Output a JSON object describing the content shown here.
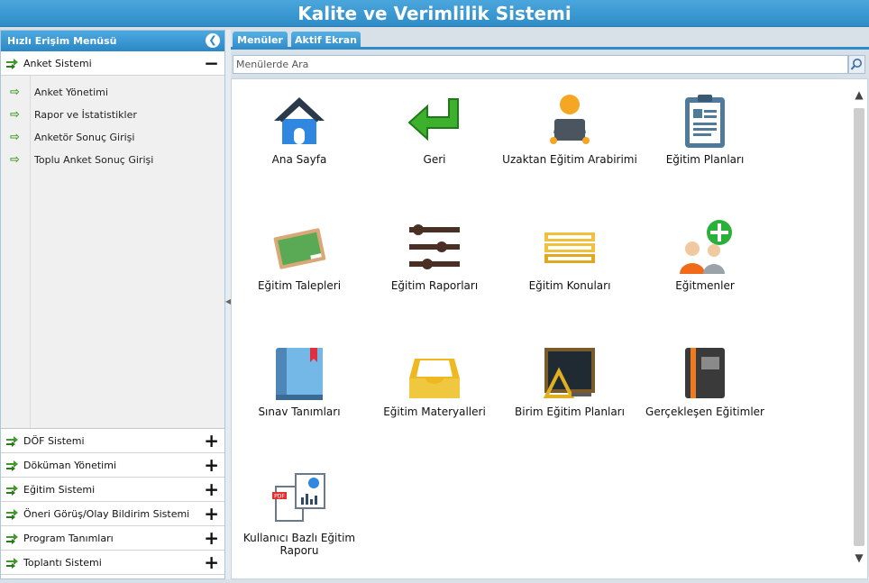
{
  "app": {
    "title": "Kalite ve Verimlilik Sistemi"
  },
  "sidebar": {
    "header": "Hızlı Erişim Menüsü",
    "open_section": {
      "label": "Anket Sistemi",
      "toggle": "−",
      "items": [
        {
          "label": "Anket Yönetimi"
        },
        {
          "label": "Rapor ve İstatistikler"
        },
        {
          "label": "Anketör Sonuç Girişi"
        },
        {
          "label": "Toplu Anket Sonuç Girişi"
        }
      ]
    },
    "sections": [
      {
        "label": "DÖF Sistemi",
        "toggle": "+"
      },
      {
        "label": "Döküman Yönetimi",
        "toggle": "+"
      },
      {
        "label": "Eğitim Sistemi",
        "toggle": "+"
      },
      {
        "label": "Öneri Görüş/Olay Bildirim Sistemi",
        "toggle": "+"
      },
      {
        "label": "Program Tanımları",
        "toggle": "+"
      },
      {
        "label": "Toplantı Sistemi",
        "toggle": "+"
      }
    ]
  },
  "tabs": [
    {
      "label": "Menüler"
    },
    {
      "label": "Aktif Ekran"
    }
  ],
  "search": {
    "placeholder": "Menülerde Ara"
  },
  "tiles": [
    {
      "label": "Ana Sayfa",
      "icon": "home-icon"
    },
    {
      "label": "Geri",
      "icon": "back-arrow-icon"
    },
    {
      "label": "Uzaktan Eğitim Arabirimi",
      "icon": "remote-learner-icon"
    },
    {
      "label": "Eğitim Planları",
      "icon": "clipboard-icon"
    },
    {
      "label": "Eğitim Talepleri",
      "icon": "chalkboard-icon"
    },
    {
      "label": "Eğitim Raporları",
      "icon": "sliders-icon"
    },
    {
      "label": "Eğitim Konuları",
      "icon": "stack-icon"
    },
    {
      "label": "Eğitmenler",
      "icon": "trainers-add-icon"
    },
    {
      "label": "Sınav Tanımları",
      "icon": "book-icon"
    },
    {
      "label": "Eğitim Materyalleri",
      "icon": "tray-icon"
    },
    {
      "label": "Birim Eğitim Planları",
      "icon": "blackboard-icon"
    },
    {
      "label": "Gerçekleşen Eğitimler",
      "icon": "notebook-icon"
    },
    {
      "label": "Kullanıcı Bazlı Eğitim Raporu",
      "icon": "pdf-report-icon"
    }
  ],
  "colors": {
    "accent": "#2e8ac8",
    "header_text": "#ffffff",
    "arrow_green": "#3f9a2a"
  }
}
